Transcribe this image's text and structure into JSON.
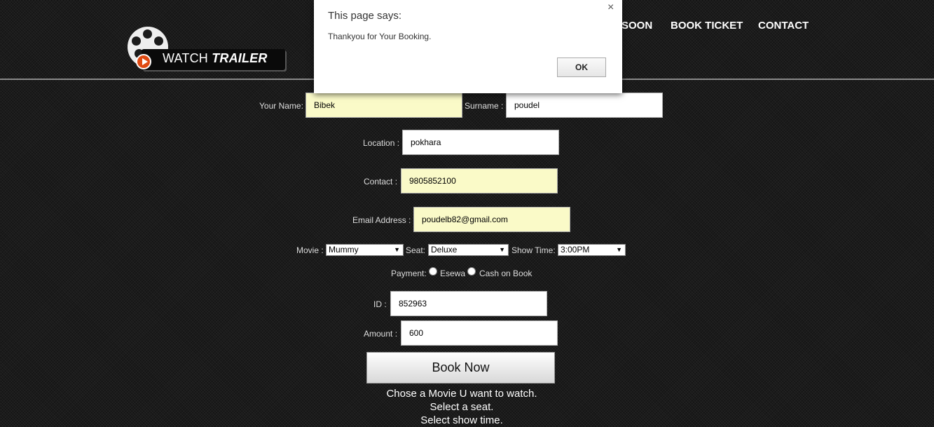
{
  "logo": {
    "word1": "WATCH",
    "word2": "TRAILER"
  },
  "nav": {
    "items": [
      "SOON",
      "BOOK TICKET",
      "CONTACT"
    ]
  },
  "form": {
    "name_label": "Your Name:",
    "name_value": "Bibek",
    "surname_label": "Surname :",
    "surname_value": "poudel",
    "location_label": "Location :",
    "location_value": "pokhara",
    "contact_label": "Contact :",
    "contact_value": "9805852100",
    "email_label": "Email Address :",
    "email_value": "poudelb82@gmail.com",
    "movie_label": "Movie :",
    "movie_value": "Mummy",
    "seat_label": "Seat:",
    "seat_value": "Deluxe",
    "showtime_label": "Show Time:",
    "showtime_value": "3:00PM",
    "payment_label": "Payment:",
    "payment_options": [
      "Esewa",
      "Cash on Book"
    ],
    "id_label": "ID :",
    "id_value": "852963",
    "amount_label": "Amount :",
    "amount_value": "600",
    "book_button": "Book Now",
    "notes": [
      "Chose a Movie U want to watch.",
      "Select a seat.",
      "Select show time."
    ]
  },
  "dialog": {
    "title": "This page says:",
    "message": "Thankyou for Your Booking.",
    "close": "×",
    "ok": "OK"
  },
  "icons": {
    "reel": "film-reel-icon",
    "play": "play-icon",
    "close": "close-icon",
    "select_arrow": "dropdown-arrow-icon"
  },
  "colors": {
    "background": "#1b1b1b",
    "autofill": "#fafac8",
    "play_button": "#e04a12"
  }
}
